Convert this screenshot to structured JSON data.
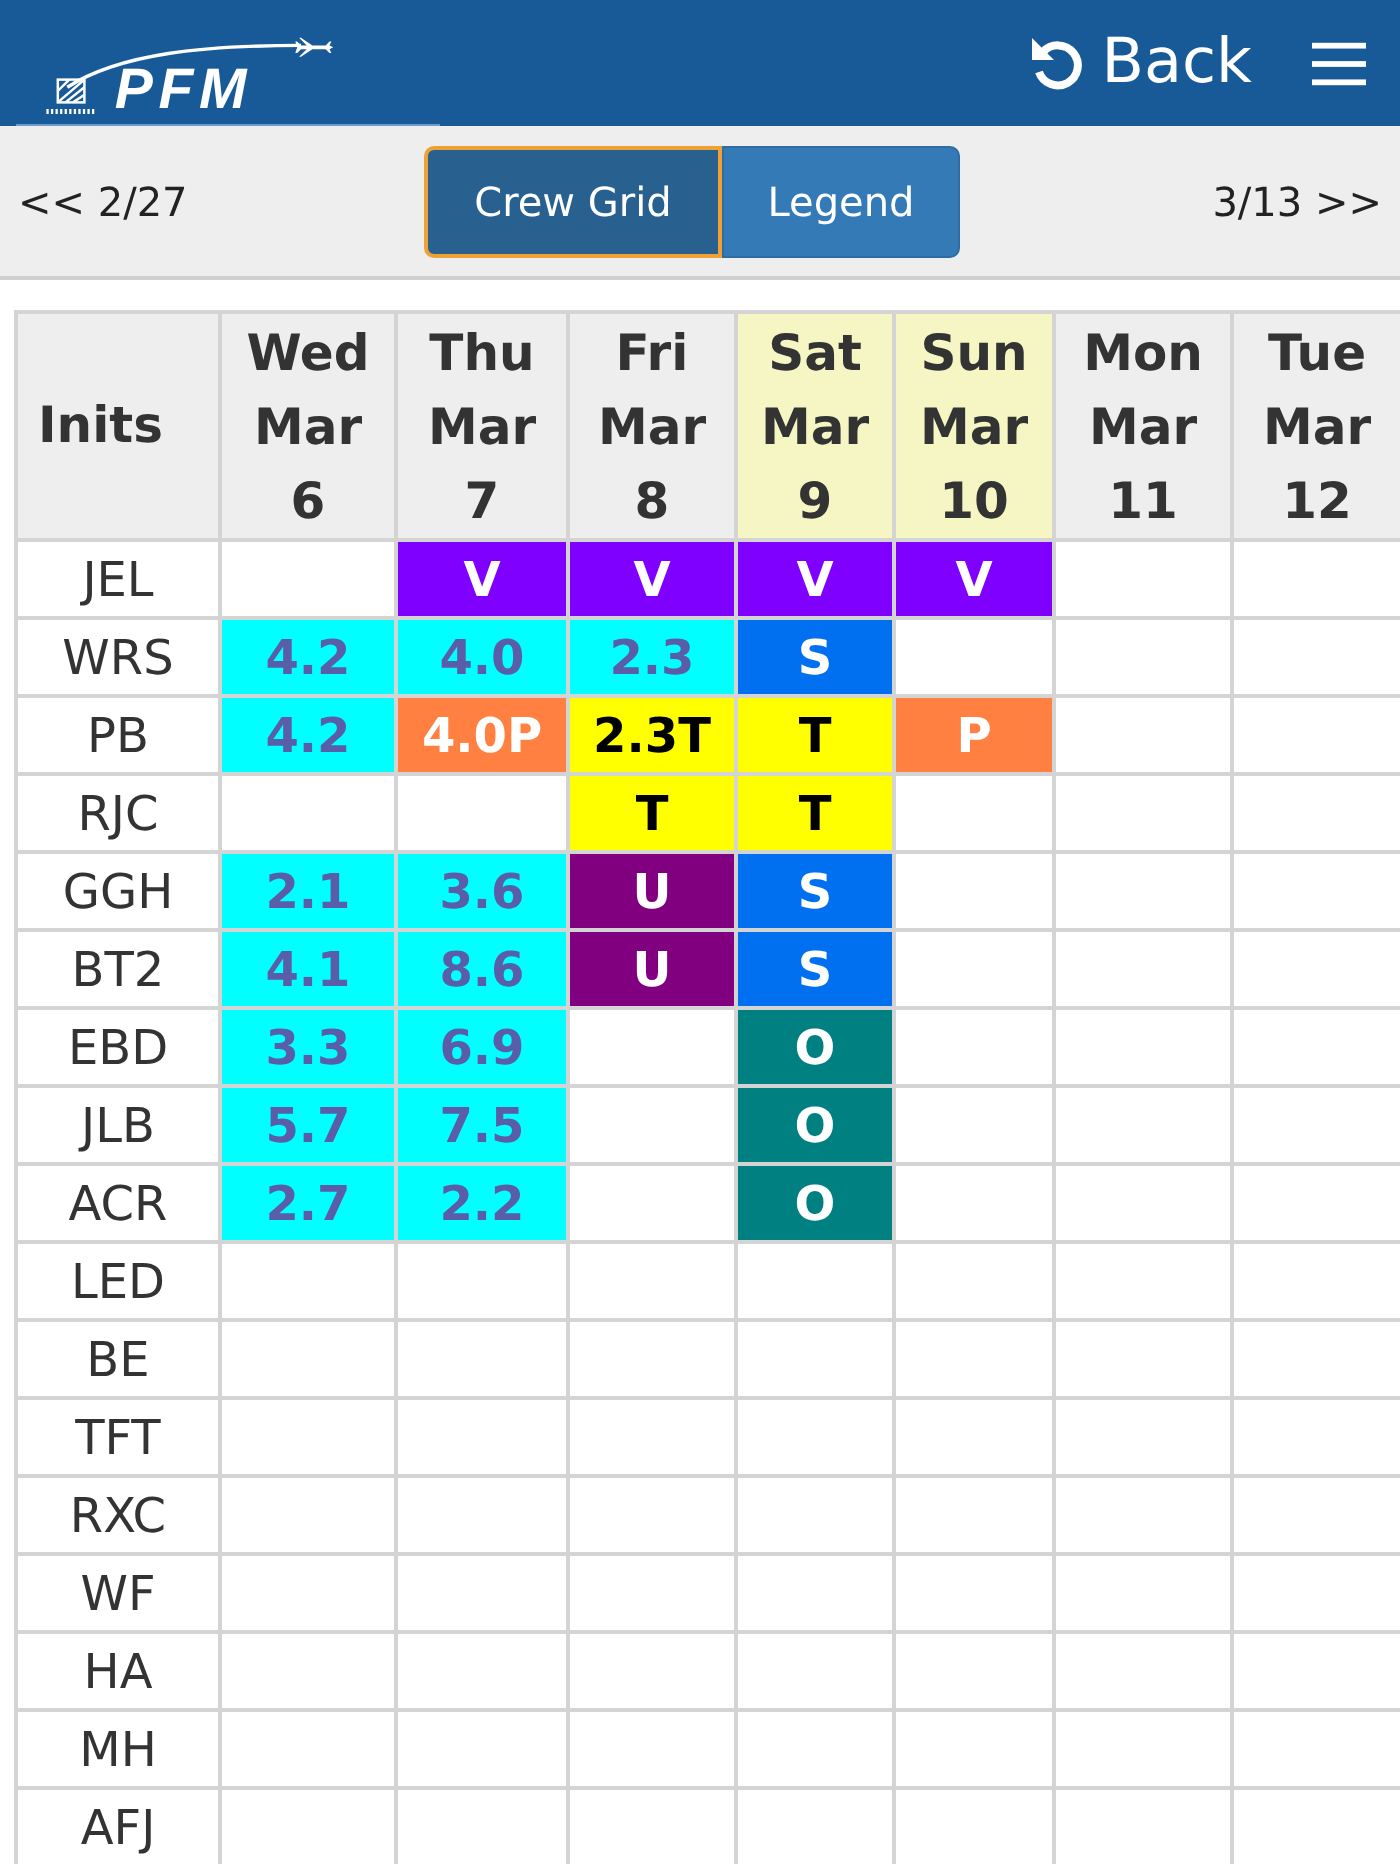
{
  "header": {
    "logo_text": "PFM",
    "back_label": "Back"
  },
  "nav": {
    "previous": "<< 2/27",
    "tabs": [
      {
        "label": "Crew Grid",
        "selected": true
      },
      {
        "label": "Legend",
        "selected": false
      }
    ],
    "next": "3/13 >>"
  },
  "grid": {
    "corner_label": "Inits",
    "columns": [
      {
        "day": "Wed",
        "month": "Mar",
        "date": "6",
        "weekend": false
      },
      {
        "day": "Thu",
        "month": "Mar",
        "date": "7",
        "weekend": false
      },
      {
        "day": "Fri",
        "month": "Mar",
        "date": "8",
        "weekend": false
      },
      {
        "day": "Sat",
        "month": "Mar",
        "date": "9",
        "weekend": true
      },
      {
        "day": "Sun",
        "month": "Mar",
        "date": "10",
        "weekend": true
      },
      {
        "day": "Mon",
        "month": "Mar",
        "date": "11",
        "weekend": false
      },
      {
        "day": "Tue",
        "month": "Mar",
        "date": "12",
        "weekend": false
      }
    ],
    "rows": [
      {
        "inits": "JEL",
        "cells": [
          null,
          {
            "text": "V",
            "color": "#8000ff"
          },
          {
            "text": "V",
            "color": "#8000ff"
          },
          {
            "text": "V",
            "color": "#8000ff"
          },
          {
            "text": "V",
            "color": "#8000ff"
          },
          null,
          null
        ]
      },
      {
        "inits": "WRS",
        "cells": [
          {
            "text": "4.2",
            "color": "#00ffff"
          },
          {
            "text": "4.0",
            "color": "#00ffff"
          },
          {
            "text": "2.3",
            "color": "#00ffff"
          },
          {
            "text": "S",
            "color": "#0070f0"
          },
          null,
          null,
          null
        ]
      },
      {
        "inits": "PB",
        "cells": [
          {
            "text": "4.2",
            "color": "#00ffff"
          },
          {
            "text": "4.0P",
            "color": "#ff8040"
          },
          {
            "text": "2.3T",
            "color": "#ffff00"
          },
          {
            "text": "T",
            "color": "#ffff00"
          },
          {
            "text": "P",
            "color": "#ff8040"
          },
          null,
          null
        ]
      },
      {
        "inits": "RJC",
        "cells": [
          null,
          null,
          {
            "text": "T",
            "color": "#ffff00"
          },
          {
            "text": "T",
            "color": "#ffff00"
          },
          null,
          null,
          null
        ]
      },
      {
        "inits": "GGH",
        "cells": [
          {
            "text": "2.1",
            "color": "#00ffff"
          },
          {
            "text": "3.6",
            "color": "#00ffff"
          },
          {
            "text": "U",
            "color": "#800080"
          },
          {
            "text": "S",
            "color": "#0070f0"
          },
          null,
          null,
          null
        ]
      },
      {
        "inits": "BT2",
        "cells": [
          {
            "text": "4.1",
            "color": "#00ffff"
          },
          {
            "text": "8.6",
            "color": "#00ffff"
          },
          {
            "text": "U",
            "color": "#800080"
          },
          {
            "text": "S",
            "color": "#0070f0"
          },
          null,
          null,
          null
        ]
      },
      {
        "inits": "EBD",
        "cells": [
          {
            "text": "3.3",
            "color": "#00ffff"
          },
          {
            "text": "6.9",
            "color": "#00ffff"
          },
          null,
          {
            "text": "O",
            "color": "#008080"
          },
          null,
          null,
          null
        ]
      },
      {
        "inits": "JLB",
        "cells": [
          {
            "text": "5.7",
            "color": "#00ffff"
          },
          {
            "text": "7.5",
            "color": "#00ffff"
          },
          null,
          {
            "text": "O",
            "color": "#008080"
          },
          null,
          null,
          null
        ]
      },
      {
        "inits": "ACR",
        "cells": [
          {
            "text": "2.7",
            "color": "#00ffff"
          },
          {
            "text": "2.2",
            "color": "#00ffff"
          },
          null,
          {
            "text": "O",
            "color": "#008080"
          },
          null,
          null,
          null
        ]
      },
      {
        "inits": "LED"
      },
      {
        "inits": "BE"
      },
      {
        "inits": "TFT"
      },
      {
        "inits": "RXC"
      },
      {
        "inits": "WF"
      },
      {
        "inits": "HA"
      },
      {
        "inits": "MH"
      },
      {
        "inits": "AFJ"
      }
    ]
  }
}
